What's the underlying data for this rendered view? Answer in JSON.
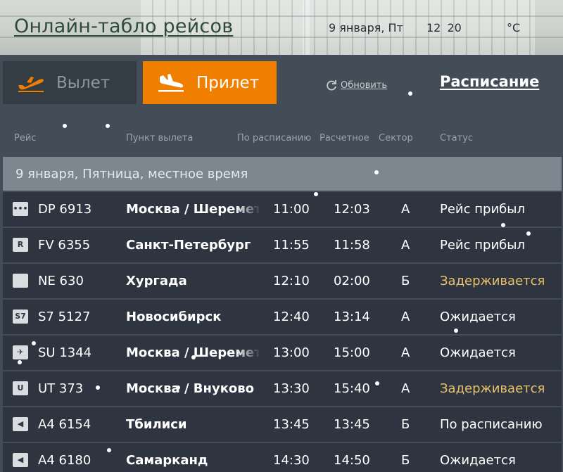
{
  "header": {
    "title": "Онлайн-табло рейсов",
    "date": "9 января, Пт",
    "time": "12 20",
    "temperature": "°C"
  },
  "tabs": {
    "departure_label": "Вылет",
    "arrival_label": "Прилет",
    "active": "arrival"
  },
  "toolbar": {
    "refresh_label": "Обновить",
    "schedule_label": "Расписание"
  },
  "columns": {
    "flight": "Рейс",
    "origin": "Пункт вылета",
    "scheduled": "По расписанию",
    "estimated": "Расчетное",
    "sector": "Сектор",
    "status": "Статус"
  },
  "date_band": "9 января, Пятница, местное время",
  "colors": {
    "accent": "#f07f00",
    "delay": "#eac06b",
    "row_bg": "#2e3540",
    "band_bg": "#7d878f"
  },
  "flights": [
    {
      "logo": "airline-logo-dots-icon",
      "flight": "DP 6913",
      "origin": "Москва / Шереметьево",
      "scheduled": "11:00",
      "estimated": "12:03",
      "sector": "А",
      "status": "Рейс прибыл",
      "status_type": "normal"
    },
    {
      "logo": "airline-logo-r-icon",
      "flight": "FV 6355",
      "origin": "Санкт-Петербург",
      "scheduled": "11:55",
      "estimated": "11:58",
      "sector": "А",
      "status": "Рейс прибыл",
      "status_type": "normal"
    },
    {
      "logo": "airline-logo-white-icon",
      "flight": "NE 630",
      "origin": "Хургада",
      "scheduled": "12:10",
      "estimated": "02:00",
      "sector": "Б",
      "status": "Задерживается",
      "status_type": "delay"
    },
    {
      "logo": "airline-logo-s7-icon",
      "flight": "S7 5127",
      "origin": "Новосибирск",
      "scheduled": "12:40",
      "estimated": "13:14",
      "sector": "А",
      "status": "Ожидается",
      "status_type": "normal"
    },
    {
      "logo": "airline-logo-aeroflot-icon",
      "flight": "SU 1344",
      "origin": "Москва / Шереметьево",
      "scheduled": "13:00",
      "estimated": "15:00",
      "sector": "А",
      "status": "Ожидается",
      "status_type": "normal"
    },
    {
      "logo": "airline-logo-utair-icon",
      "flight": "UT 373",
      "origin": "Москва / Внуково",
      "scheduled": "13:30",
      "estimated": "15:40",
      "sector": "А",
      "status": "Задерживается",
      "status_type": "delay"
    },
    {
      "logo": "airline-logo-a4-icon",
      "flight": "A4 6154",
      "origin": "Тбилиси",
      "scheduled": "13:45",
      "estimated": "13:45",
      "sector": "Б",
      "status": "По расписанию",
      "status_type": "normal"
    },
    {
      "logo": "airline-logo-a4-icon",
      "flight": "A4 6180",
      "origin": "Самарканд",
      "scheduled": "14:30",
      "estimated": "14:50",
      "sector": "Б",
      "status": "Ожидается",
      "status_type": "normal"
    }
  ]
}
